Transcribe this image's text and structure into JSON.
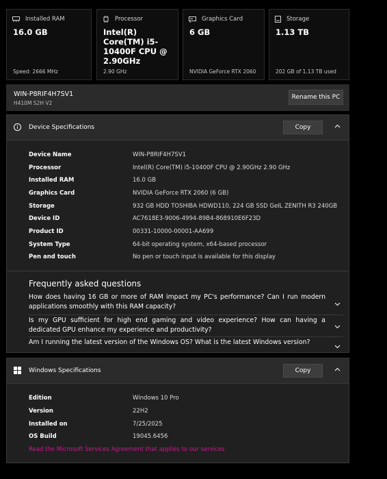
{
  "cards": [
    {
      "title": "Installed RAM",
      "value": "16.0 GB",
      "sub": "Speed: 2666 MHz",
      "icon": "ram-icon"
    },
    {
      "title": "Processor",
      "value": "Intel(R) Core(TM) i5-10400F CPU @ 2.90GHz",
      "sub": "2.90 GHz",
      "icon": "processor-icon"
    },
    {
      "title": "Graphics Card",
      "value": "6 GB",
      "sub": "NVIDIA GeForce RTX 2060",
      "icon": "graphics-card-icon"
    },
    {
      "title": "Storage",
      "value": "1.13 TB",
      "sub": "202 GB of 1.13 TB used",
      "icon": "storage-icon"
    }
  ],
  "pc": {
    "name": "WIN-P8RIF4H7SV1",
    "model": "H410M S2H V2",
    "rename_label": "Rename this PC"
  },
  "device_specs": {
    "title": "Device Specifications",
    "copy_label": "Copy",
    "rows": [
      {
        "label": "Device Name",
        "value": "WIN-P8RIF4H7SV1"
      },
      {
        "label": "Processor",
        "value": "Intel(R) Core(TM) i5-10400F CPU @ 2.90GHz   2.90 GHz"
      },
      {
        "label": "Installed RAM",
        "value": "16.0 GB"
      },
      {
        "label": "Graphics Card",
        "value": "NVIDIA GeForce RTX 2060 (6 GB)"
      },
      {
        "label": "Storage",
        "value": "932 GB HDD TOSHIBA HDWD110, 224 GB SSD GeIL    ZENITH R3 240GB"
      },
      {
        "label": "Device ID",
        "value": "AC7618E3-9006-4994-89B4-868910E6F23D"
      },
      {
        "label": "Product ID",
        "value": "00331-10000-00001-AA699"
      },
      {
        "label": "System Type",
        "value": "64-bit operating system, x64-based processor"
      },
      {
        "label": "Pen and touch",
        "value": "No pen or touch input is available for this display"
      }
    ]
  },
  "faq": {
    "title": "Frequently asked questions",
    "items": [
      "How does having 16 GB or more of RAM impact my PC's performance? Can I run modern applications smoothly with this RAM capacity?",
      "Is my GPU sufficient for high end gaming and video experience? How can having a dedicated GPU enhance my experience and productivity?",
      "Am I running the latest version of the Windows OS? What is the latest Windows version?"
    ]
  },
  "windows_specs": {
    "title": "Windows Specifications",
    "copy_label": "Copy",
    "rows": [
      {
        "label": "Edition",
        "value": "Windows 10 Pro"
      },
      {
        "label": "Version",
        "value": "22H2"
      },
      {
        "label": "Installed on",
        "value": "7/25/2025"
      },
      {
        "label": "OS Build",
        "value": "19045.6456"
      }
    ],
    "link": "Read the Microsoft Services Agreement that applies to our services"
  },
  "colors": {
    "accent_link": "#c91b8f",
    "panel": "#2b2b2b",
    "panel_body": "#202020",
    "background": "#000000"
  }
}
